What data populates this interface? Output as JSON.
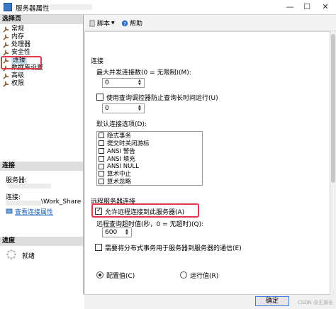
{
  "window": {
    "title": "服务器属性 -",
    "minimize_glyph": "—",
    "maximize_glyph": "☐",
    "close_glyph": "✕"
  },
  "left_pane": {
    "select_page_header": "选择页",
    "nav_items": [
      {
        "label": "常规",
        "icon": "wrench-icon"
      },
      {
        "label": "内存",
        "icon": "wrench-icon"
      },
      {
        "label": "处理器",
        "icon": "wrench-icon"
      },
      {
        "label": "安全性",
        "icon": "wrench-icon"
      },
      {
        "label": "连接",
        "icon": "wrench-icon",
        "active": true
      },
      {
        "label": "数据库设置",
        "icon": "wrench-icon"
      },
      {
        "label": "高级",
        "icon": "wrench-icon"
      },
      {
        "label": "权限",
        "icon": "wrench-icon"
      }
    ],
    "connection_header": "连接",
    "server_label": "服务器:",
    "connection_label": "连接:",
    "connection_value": "\\Work_Share",
    "view_connection_link": "查看连接属性",
    "progress_header": "进度",
    "progress_status": "就绪"
  },
  "toolbar": {
    "script_label": "脚本",
    "help_label": "帮助"
  },
  "content": {
    "connections_section": "连接",
    "max_connections_label": "最大并发连接数(0 = 无限制)(M):",
    "max_connections_value": "0",
    "query_governor_label": "使用查询调控器防止查询长时间运行(U)",
    "query_governor_value": "0",
    "default_options_label": "默认连接选项(D):",
    "default_options": [
      "隐式事务",
      "提交时关闭游标",
      "ANSI 警告",
      "ANSI 填充",
      "ANSI NULL",
      "算术中止",
      "算术忽略"
    ],
    "remote_section": "远程服务器连接",
    "allow_remote_label": "允许远程连接到此服务器(A)",
    "allow_remote_checked": true,
    "remote_timeout_label": "远程查询超时值(秒，0 = 无超时)(Q):",
    "remote_timeout_value": "600",
    "require_dtc_label": "需要将分布式事务用于服务器到服务器的通信(E)",
    "configured_values_label": "配置值(C)",
    "running_values_label": "运行值(R)",
    "selected_view": "configured"
  },
  "footer": {
    "ok_label": "确定",
    "watermark": "CSDN @王源长"
  },
  "colors": {
    "highlight_box": "#e0384a",
    "selection_bg": "#cce4f7",
    "header_bg": "#dddddd",
    "link": "#1a5fb4",
    "icon_brown": "#7a4a1e"
  }
}
